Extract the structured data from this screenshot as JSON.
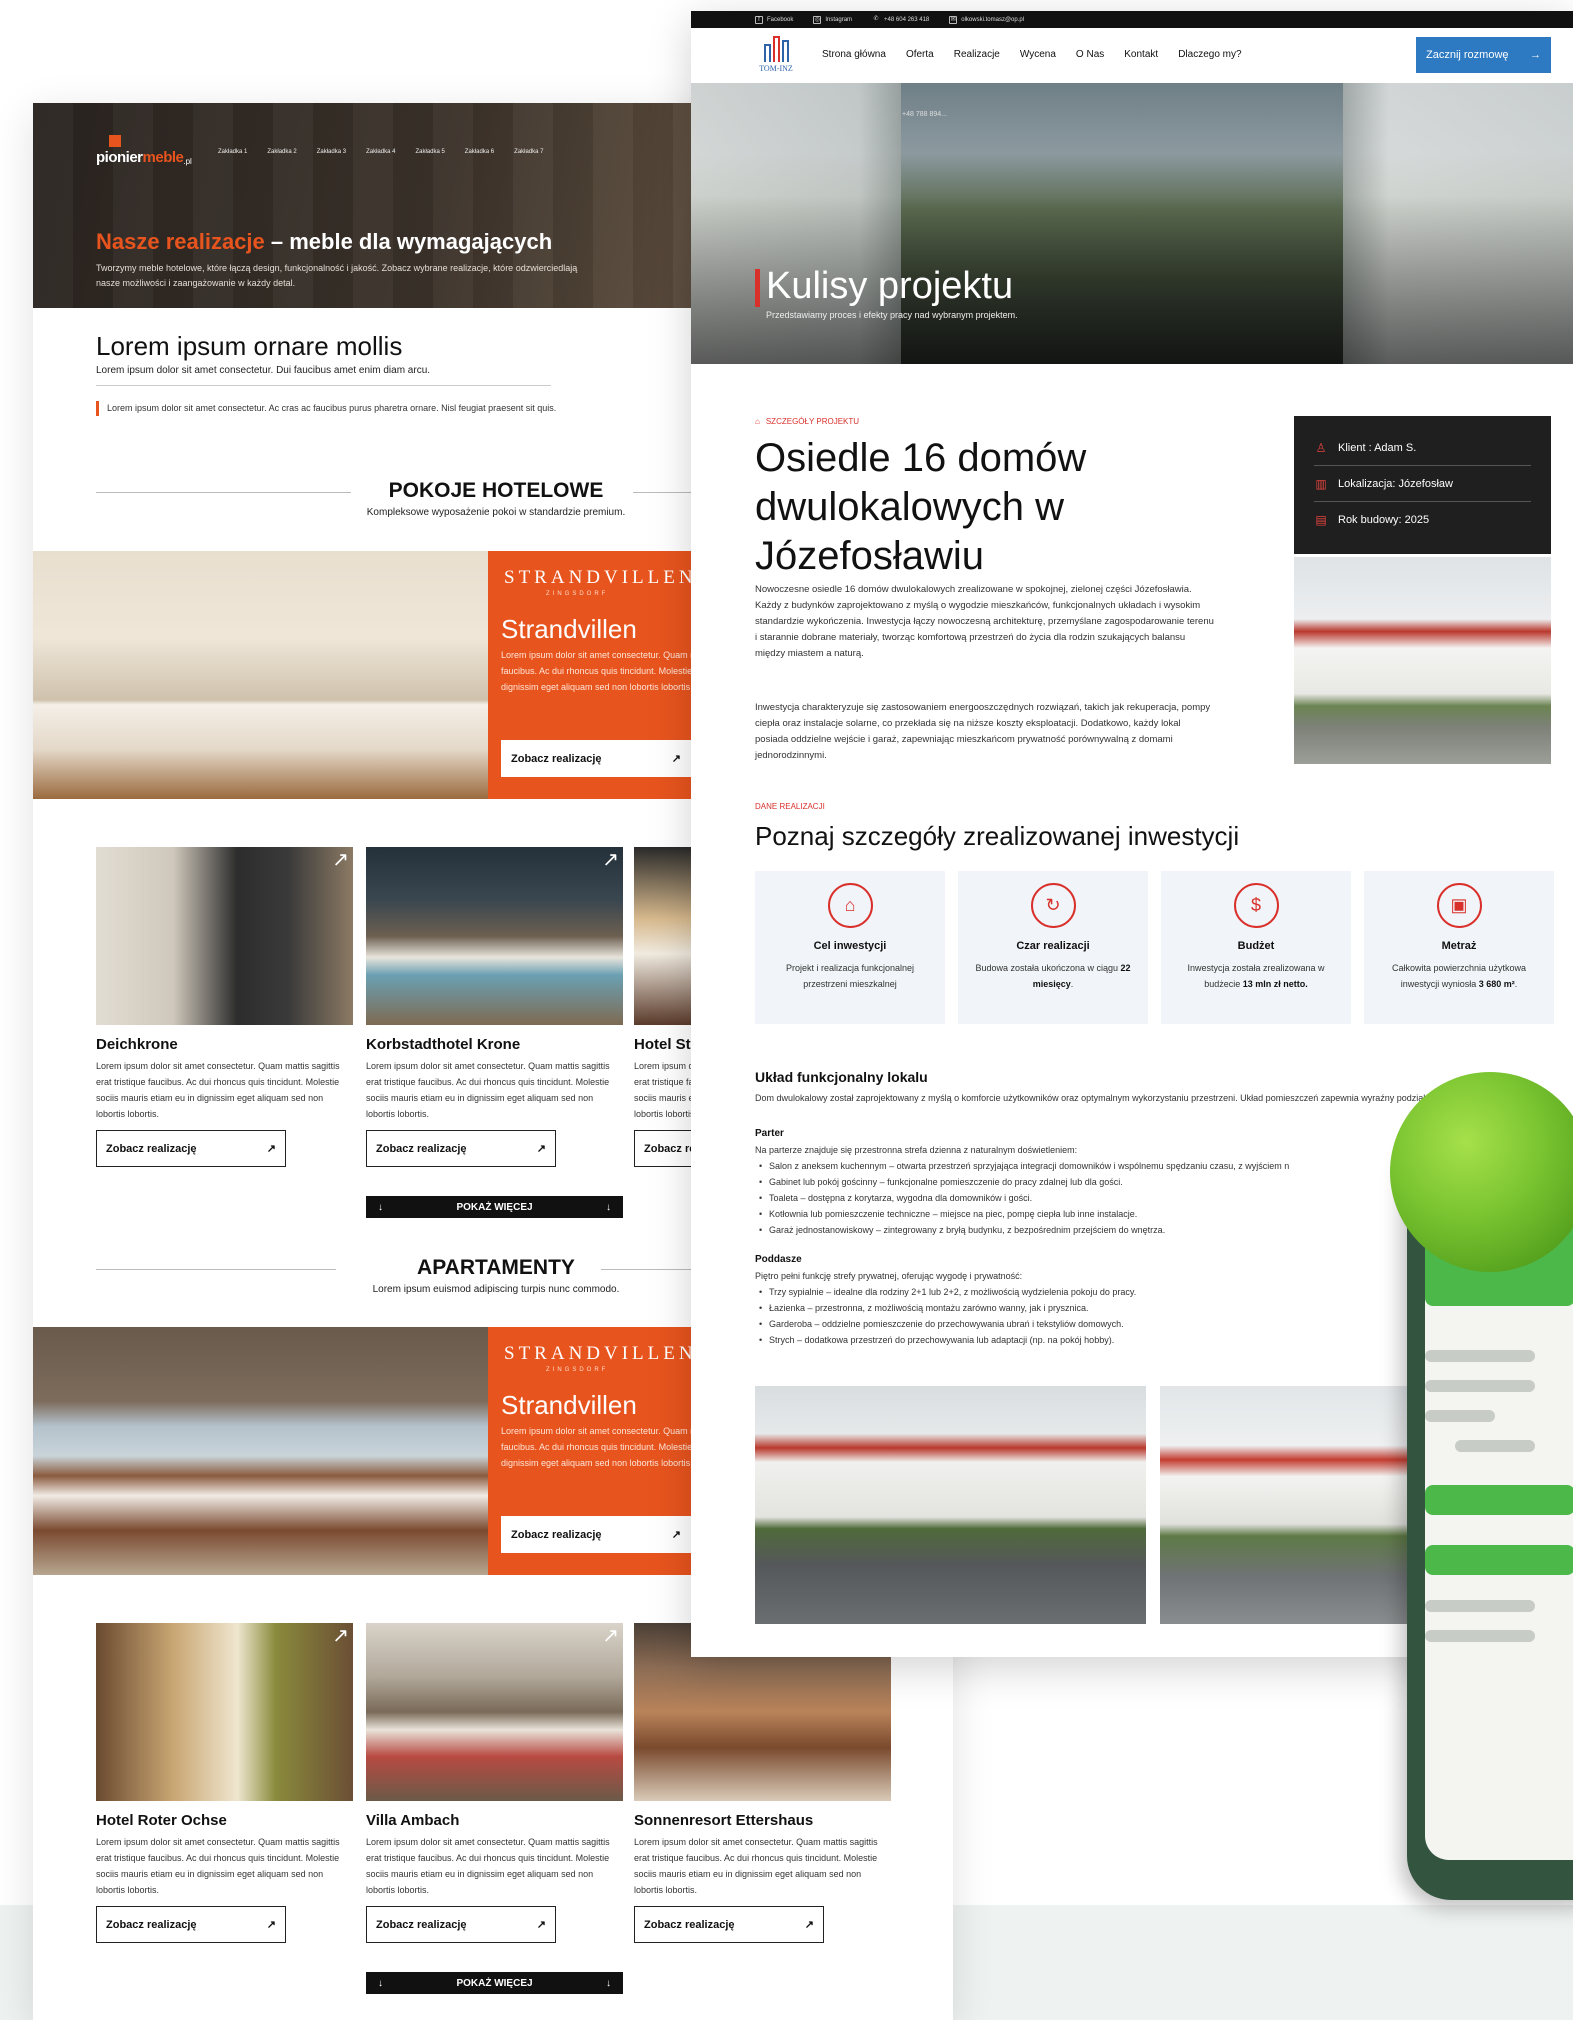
{
  "left_page": {
    "phone": "+48 788 894...",
    "logo": {
      "part1": "pionier",
      "part2": "meble",
      "part3": ".pl"
    },
    "nav": [
      "Zakładka 1",
      "Zakładka 2",
      "Zakładka 3",
      "Zakładka 4",
      "Zakładka 5",
      "Zakładka 6",
      "Zakładka 7"
    ],
    "hero": {
      "title_accent": "Nasze realizacje",
      "title_rest": " – meble dla wymagających",
      "subtitle": "Tworzymy meble hotelowe, które łączą design, funkcjonalność i jakość. Zobacz wybrane realizacje, które odzwierciedlają nasze możliwości i zaangażowanie w każdy detal."
    },
    "intro": {
      "title": "Lorem ipsum ornare mollis",
      "subtitle": "Lorem ipsum dolor sit amet consectetur. Dui faucibus amet enim diam arcu.",
      "quote": "Lorem ipsum dolor sit amet consectetur. Ac cras ac faucibus purus pharetra ornare. Nisl feugiat praesent sit quis."
    },
    "section1": {
      "title": "POKOJE HOTELOWE",
      "subtitle": "Kompleksowe wyposażenie pokoi w standardzie premium.",
      "feature": {
        "brand": "STRANDVILLEN",
        "brand_sub": "ZINGSDORF",
        "name": "Strandvillen",
        "desc": "Lorem ipsum dolor sit amet consectetur. Quam mattis sagittis erat tristique faucibus. Ac dui rhoncus quis tincidunt. Molestie sociis mauris etiam eu in dignissim eget aliquam sed non lobortis lobortis.",
        "button": "Zobacz realizację"
      },
      "cards": [
        {
          "title": "Deichkrone",
          "desc": "Lorem ipsum dolor sit amet consectetur. Quam mattis sagittis erat tristique faucibus. Ac dui rhoncus quis tincidunt. Molestie sociis mauris etiam eu in dignissim eget aliquam sed non lobortis lobortis.",
          "button": "Zobacz realizację"
        },
        {
          "title": "Korbstadthotel Krone",
          "desc": "Lorem ipsum dolor sit amet consectetur. Quam mattis sagittis erat tristique faucibus. Ac dui rhoncus quis tincidunt. Molestie sociis mauris etiam eu in dignissim eget aliquam sed non lobortis lobortis.",
          "button": "Zobacz realizację"
        },
        {
          "title": "Hotel St",
          "desc": "Lorem ipsum dolor sit amet consectetur. Quam mattis sagittis erat tristique faucibus. Ac dui rhoncus quis tincidunt. Molestie sociis mauris etiam eu in dignissim eget aliquam sed non lobortis lobortis.",
          "button": "Zobacz realizację"
        }
      ],
      "more": "POKAŻ WIĘCEJ"
    },
    "section2": {
      "title": "APARTAMENTY",
      "subtitle": "Lorem ipsum euismod adipiscing turpis nunc commodo.",
      "feature": {
        "brand": "STRANDVILLEN",
        "brand_sub": "ZINGSDORF",
        "name": "Strandvillen",
        "desc": "Lorem ipsum dolor sit amet consectetur. Quam mattis sagittis erat tristique faucibus. Ac dui rhoncus quis tincidunt. Molestie sociis mauris etiam eu in dignissim eget aliquam sed non lobortis lobortis.",
        "button": "Zobacz realizację"
      },
      "cards": [
        {
          "title": "Hotel Roter Ochse",
          "desc": "Lorem ipsum dolor sit amet consectetur. Quam mattis sagittis erat tristique faucibus. Ac dui rhoncus quis tincidunt. Molestie sociis mauris etiam eu in dignissim eget aliquam sed non lobortis lobortis.",
          "button": "Zobacz realizację"
        },
        {
          "title": "Villa Ambach",
          "desc": "Lorem ipsum dolor sit amet consectetur. Quam mattis sagittis erat tristique faucibus. Ac dui rhoncus quis tincidunt. Molestie sociis mauris etiam eu in dignissim eget aliquam sed non lobortis lobortis.",
          "button": "Zobacz realizację"
        },
        {
          "title": "Sonnenresort Ettershaus",
          "desc": "Lorem ipsum dolor sit amet consectetur. Quam mattis sagittis erat tristique faucibus. Ac dui rhoncus quis tincidunt. Molestie sociis mauris etiam eu in dignissim eget aliquam sed non lobortis lobortis.",
          "button": "Zobacz realizację"
        }
      ],
      "more": "POKAŻ WIĘCEJ"
    }
  },
  "right_page": {
    "topbar": {
      "facebook": "Facebook",
      "instagram": "Instagram",
      "phone": "+48 604 263 418",
      "email": "olkowski.tomasz@op.pl"
    },
    "logo": "TOM-INZ",
    "nav": [
      "Strona główna",
      "Oferta",
      "Realizacje",
      "Wycena",
      "O Nas",
      "Kontakt",
      "Dlaczego my?"
    ],
    "cta": "Zacznij rozmowę",
    "hero": {
      "title": "Kulisy projektu",
      "subtitle": "Przedstawiamy proces i efekty pracy nad wybranym projektem."
    },
    "details_kicker": "SZCZEGÓŁY PROJEKTU",
    "project_title": "Osiedle 16 domów dwulokalowych w Józefosławiu",
    "para1": "Nowoczesne osiedle 16 domów dwulokalowych zrealizowane w spokojnej, zielonej części Józefosławia. Każdy z budynków zaprojektowano z myślą o wygodzie mieszkańców, funkcjonalnych układach i wysokim standardzie wykończenia. Inwestycja łączy nowoczesną architekturę, przemyślane zagospodarowanie terenu i starannie dobrane materiały, tworząc komfortową przestrzeń do życia dla rodzin szukających balansu między miastem a naturą.",
    "para2": "Inwestycja charakteryzuje się zastosowaniem energooszczędnych rozwiązań, takich jak rekuperacja, pompy ciepła oraz instalacje solarne, co przekłada się na niższe koszty eksploatacji. Dodatkowo, każdy lokal posiada oddzielne wejście i garaż, zapewniając mieszkańcom prywatność porównywalną z domami jednorodzinnymi.",
    "info": {
      "client": "Klient : Adam S.",
      "location": "Lokalizacja: Józefosław",
      "year": "Rok budowy: 2025"
    },
    "data_kicker": "DANE REALIZACJI",
    "data_title": "Poznaj szczegóły zrealizowanej inwestycji",
    "tiles": [
      {
        "icon": "house-icon",
        "title": "Cel inwestycji",
        "text": "Projekt i realizacja funkcjonalnej przestrzeni mieszkalnej",
        "bold": "",
        "tail": ""
      },
      {
        "icon": "clock-icon",
        "title": "Czar realizacji",
        "text": "Budowa została ukończona w ciągu ",
        "bold": "22 miesięcy",
        "tail": "."
      },
      {
        "icon": "money-icon",
        "title": "Budżet",
        "text": "Inwestycja została zrealizowana w budżecie ",
        "bold": "13 mln zł netto.",
        "tail": ""
      },
      {
        "icon": "area-icon",
        "title": "Metraż",
        "text": "Całkowita powierzchnia użytkowa inwestycji wyniosła ",
        "bold": "3 680 m²",
        "tail": "."
      }
    ],
    "layout_title": "Układ funkcjonalny lokalu",
    "layout_lead": "Dom dwulokalowy został zaprojektowany z myślą o komforcie użytkowników oraz optymalnym wykorzystaniu przestrzeni. Układ pomieszczeń zapewnia wyraźny podział na strefę dzienną i prywatną.",
    "parter": {
      "title": "Parter",
      "lead": "Na parterze znajduje się przestronna strefa dzienna z naturalnym doświetleniem:",
      "items": [
        "Salon z aneksem kuchennym – otwarta przestrzeń sprzyjająca integracji domowników i wspólnemu spędzaniu czasu, z wyjściem n",
        "Gabinet lub pokój gościnny – funkcjonalne pomieszczenie do pracy zdalnej lub dla gości.",
        "Toaleta – dostępna z korytarza, wygodna dla domowników i gości.",
        "Kotłownia lub pomieszczenie techniczne – miejsce na piec, pompę ciepła lub inne instalacje.",
        "Garaż jednostanowiskowy – zintegrowany z bryłą budynku, z bezpośrednim przejściem do wnętrza."
      ]
    },
    "poddasze": {
      "title": "Poddasze",
      "lead": "Piętro pełni funkcję strefy prywatnej, oferując wygodę i prywatność:",
      "items": [
        "Trzy sypialnie – idealne dla rodziny 2+1 lub 2+2, z możliwością wydzielenia pokoju do pracy.",
        "Łazienka – przestronna, z możliwością montażu zarówno wanny, jak i prysznica.",
        "Garderoba – oddzielne pomieszczenie do przechowywania ubrań i tekstyliów domowych.",
        "Strych – dodatkowa przestrzeń do przechowywania lub adaptacji (np. na pokój hobby)."
      ]
    }
  },
  "colors": {
    "orange": "#e8541e",
    "red": "#d9302b",
    "blue": "#2d7ac3",
    "dark": "#1f1f1f",
    "tile_bg": "#f1f4f8",
    "tablet": "#33543f",
    "green": "#4cb84a"
  }
}
